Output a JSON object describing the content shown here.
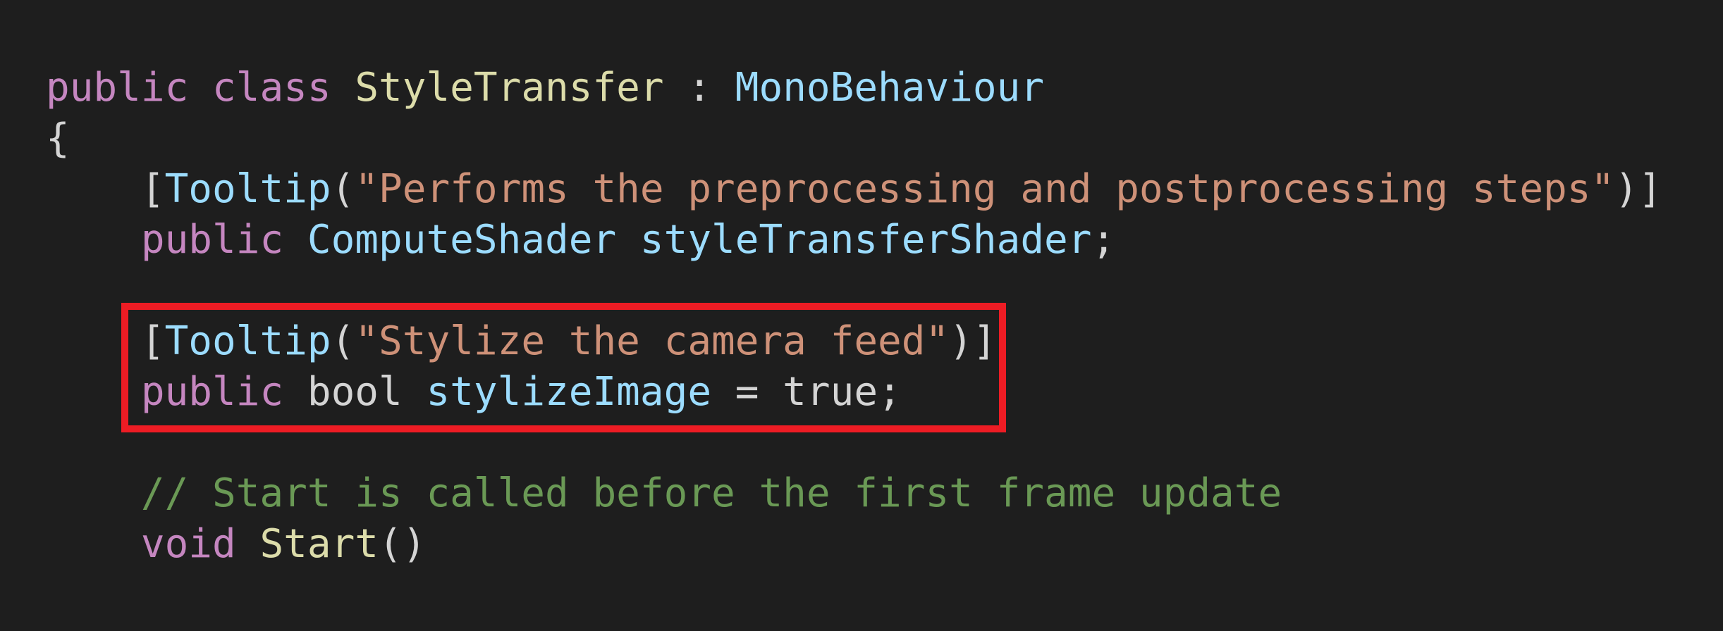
{
  "colors": {
    "background": "#1e1e1e",
    "keyword": "#c586c0",
    "class_name": "#dcdcaa",
    "type": "#9cdcfe",
    "string": "#ce9178",
    "comment": "#6a9955",
    "highlight_box": "#ed1c24"
  },
  "code_lines": [
    [
      [
        "kw",
        "public"
      ],
      [
        "plain",
        " "
      ],
      [
        "kw",
        "class"
      ],
      [
        "plain",
        " "
      ],
      [
        "cls",
        "StyleTransfer"
      ],
      [
        "plain",
        " : "
      ],
      [
        "typ",
        "MonoBehaviour"
      ]
    ],
    [
      [
        "pun",
        "{"
      ]
    ],
    [
      [
        "plain",
        "    "
      ],
      [
        "pun",
        "["
      ],
      [
        "typ",
        "Tooltip"
      ],
      [
        "pun",
        "("
      ],
      [
        "str",
        "\"Performs the preprocessing and postprocessing steps\""
      ],
      [
        "pun",
        ")]"
      ]
    ],
    [
      [
        "plain",
        "    "
      ],
      [
        "kw",
        "public"
      ],
      [
        "plain",
        " "
      ],
      [
        "typ",
        "ComputeShader"
      ],
      [
        "plain",
        " "
      ],
      [
        "typ",
        "styleTransferShader"
      ],
      [
        "pun",
        ";"
      ]
    ],
    [],
    [
      [
        "plain",
        "    "
      ],
      [
        "pun",
        "["
      ],
      [
        "typ",
        "Tooltip"
      ],
      [
        "pun",
        "("
      ],
      [
        "str",
        "\"Stylize the camera feed\""
      ],
      [
        "pun",
        ")]"
      ]
    ],
    [
      [
        "plain",
        "    "
      ],
      [
        "kw",
        "public"
      ],
      [
        "plain",
        " bool "
      ],
      [
        "typ",
        "stylizeImage"
      ],
      [
        "plain",
        " = true;"
      ]
    ],
    [],
    [
      [
        "plain",
        "    "
      ],
      [
        "cmt",
        "// Start is called before the first frame update"
      ]
    ],
    [
      [
        "plain",
        "    "
      ],
      [
        "kw",
        "void"
      ],
      [
        "plain",
        " "
      ],
      [
        "cls",
        "Start"
      ],
      [
        "pun",
        "()"
      ]
    ]
  ]
}
